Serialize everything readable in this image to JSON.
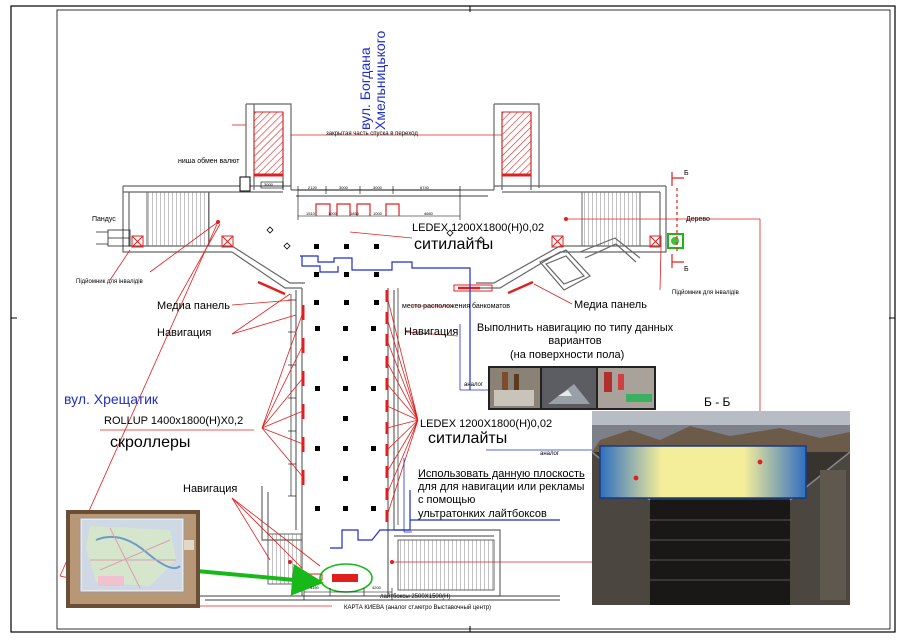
{
  "street_khmelnytsky": "вул. Богдана Хмельницького",
  "street_khreshchatyk": "вул. Хрещатик",
  "labels": {
    "closed_part": "закрытая часть спуска в переход",
    "exchange_niche": "ниша обмен валют",
    "ramp": "Пандус",
    "lift_left": "Підйомник для інвалідів",
    "lift_right": "Підйомник для інвалідів",
    "tree": "Дерево",
    "ledex_top": "LEDEX 1200X1800(H)0,02",
    "citylights_top": "ситилайты",
    "media_left": "Медиа панель",
    "media_right": "Медиа панель",
    "atm_place": "место расположения банкоматов",
    "nav_left_1": "Навигация",
    "nav_right": "Навигация",
    "nav_left_2": "Навигация",
    "floor_nav": "Выполнить навигацию по типу данных вариантов",
    "floor_nav_sub": "(на поверхности пола)",
    "analog_1": "аналог",
    "analog_2": "аналог",
    "rollup": "ROLLUP 1400x1800(H)X0,2",
    "scrollers": "скроллеры",
    "ledex_mid": "LEDEX 1200X1800(H)0,02",
    "citylights_mid": "ситилайты",
    "plane_1": "Использовать данную плоскость",
    "plane_2": "для для навигации или рекламы",
    "plane_3": "с помощью",
    "plane_4": "ультратонких лайтбоксов",
    "lightboxes": "лайтбоксы 2500Х1500(Н)",
    "kiev_map": "КАРТА КИЕВА (аналог ст.метро Выставочный центр)",
    "section": "Б - Б",
    "b_top": "Б",
    "b_bottom": "Б"
  },
  "dimensions": [
    "2120",
    "3000",
    "3000",
    "6740",
    "1510",
    "1000",
    "1850",
    "1000",
    "4660",
    "3000",
    "4160",
    "4200"
  ],
  "colors": {
    "plan_red": "#e02020",
    "note_blue": "#1f2fc8",
    "plan_gray": "#555555",
    "callout_green": "#18b818",
    "section_sign": "#2c6fc4"
  }
}
